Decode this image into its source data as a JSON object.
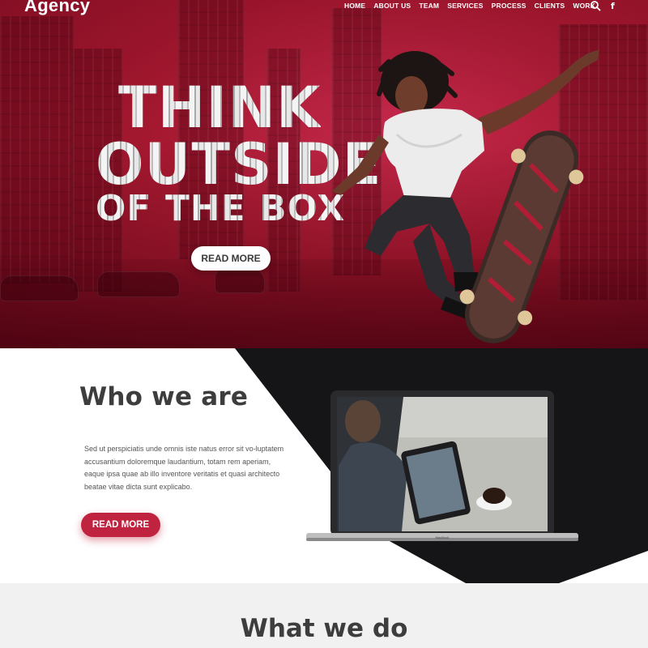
{
  "header": {
    "logo": "Agency",
    "nav": [
      "HOME",
      "ABOUT US",
      "TEAM",
      "SERVICES",
      "PROCESS",
      "CLIENTS",
      "WORK"
    ],
    "icons": [
      "search-icon",
      "facebook-icon"
    ]
  },
  "hero": {
    "headline_line1": "THINK",
    "headline_line2": "OUTSIDE",
    "headline_line3": "OF THE BOX",
    "button_label": "READ MORE",
    "accent_color": "#b41e3b"
  },
  "who": {
    "title": "Who we are",
    "paragraph": "Sed ut perspiciatis unde omnis iste natus error sit vo-luptatem accusantium doloremque laudantium, totam rem aperiam, eaque ipsa quae ab illo inventore veritatis et quasi architecto beatae vitae dicta sunt explicabo.",
    "button_label": "READ MORE",
    "button_color": "#c0233f",
    "laptop_label": "MacBook"
  },
  "what": {
    "title": "What we do"
  }
}
